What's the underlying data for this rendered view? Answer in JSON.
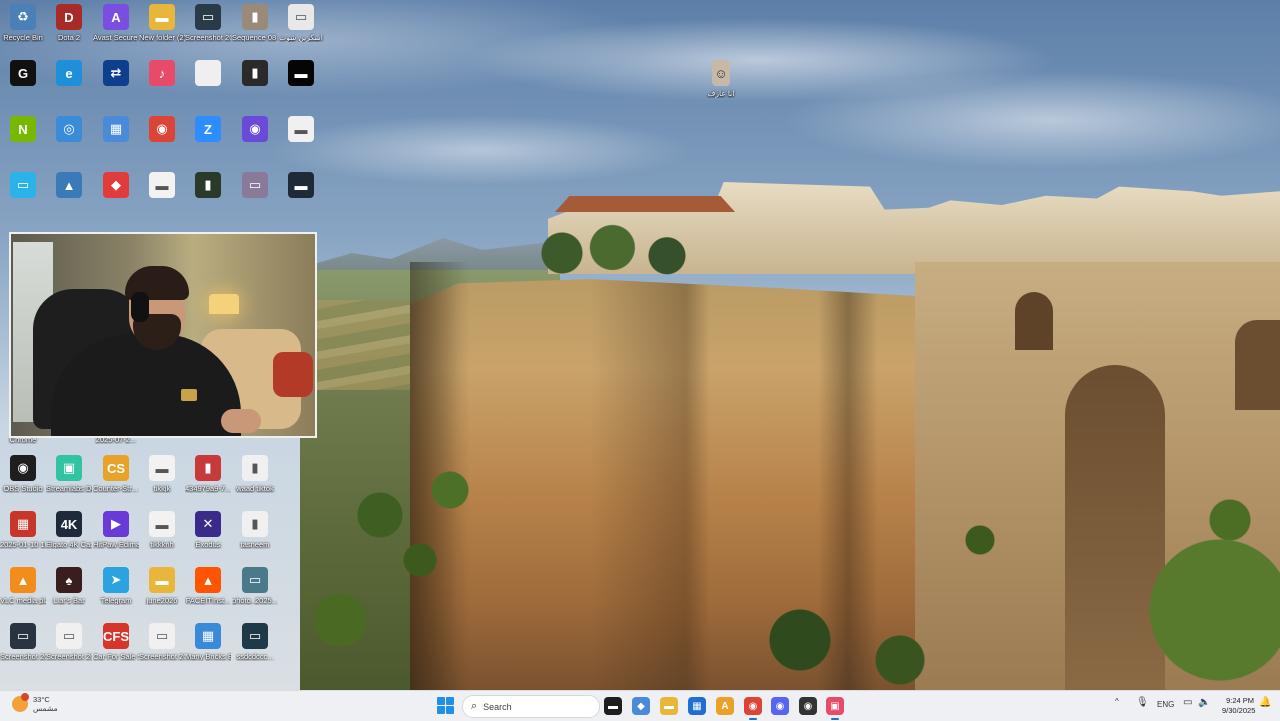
{
  "desktop": {
    "icons": [
      {
        "label": "Recycle Bin",
        "icon": "recycle-bin-icon",
        "color": "#4a7fb8",
        "glyph": "♻"
      },
      {
        "label": "Dota 2",
        "icon": "dota2-icon",
        "color": "#a82b28",
        "glyph": "D"
      },
      {
        "label": "Avast Secure Browser",
        "icon": "avast-browser-icon",
        "color": "#7a4ee0",
        "glyph": "A"
      },
      {
        "label": "New folder (2)",
        "icon": "folder-icon",
        "color": "#e8b63a",
        "glyph": "▬"
      },
      {
        "label": "Screenshot 2025-0...",
        "icon": "screenshot-file-icon",
        "color": "#2a3b48",
        "glyph": "▭"
      },
      {
        "label": "Sequence 08_1",
        "icon": "video-file-icon",
        "color": "#9a8a7a",
        "glyph": "▮"
      },
      {
        "label": "اسكرين شوت",
        "icon": "image-file-icon",
        "color": "#e8e8e8",
        "glyph": "▭"
      },
      {
        "label": "",
        "icon": "g-hub-icon",
        "color": "#111111",
        "glyph": "G"
      },
      {
        "label": "",
        "icon": "edge-icon",
        "color": "#1e8fd8",
        "glyph": "e"
      },
      {
        "label": "",
        "icon": "teamviewer-icon",
        "color": "#0e3f8c",
        "glyph": "⇄"
      },
      {
        "label": "",
        "icon": "tiktok-studio-icon",
        "color": "#e84a6a",
        "glyph": "♪"
      },
      {
        "label": "",
        "icon": "blank-file-icon",
        "color": "#efefef",
        "glyph": ""
      },
      {
        "label": "",
        "icon": "dark-image-icon",
        "color": "#2a2a2a",
        "glyph": "▮"
      },
      {
        "label": "",
        "icon": "black-file-icon",
        "color": "#050505",
        "glyph": "▬"
      },
      {
        "label": "",
        "icon": "nvidia-icon",
        "color": "#76b900",
        "glyph": "N"
      },
      {
        "label": "",
        "icon": "network-globe-icon",
        "color": "#3a8bd8",
        "glyph": "◎"
      },
      {
        "label": "",
        "icon": "windows-app-icon",
        "color": "#4a8ad8",
        "glyph": "▦"
      },
      {
        "label": "",
        "icon": "chrome-icon",
        "color": "#db4437",
        "glyph": "◉"
      },
      {
        "label": "",
        "icon": "zoom-icon",
        "color": "#2d8cff",
        "glyph": "Z"
      },
      {
        "label": "",
        "icon": "obs-like-icon",
        "color": "#6a4bd8",
        "glyph": "◉"
      },
      {
        "label": "",
        "icon": "white-file-icon",
        "color": "#f0f0f0",
        "glyph": "▬"
      },
      {
        "label": "",
        "icon": "monitor-icon",
        "color": "#2bb2e8",
        "glyph": "▭"
      },
      {
        "label": "",
        "icon": "game-icon",
        "color": "#3a7ab8",
        "glyph": "▲"
      },
      {
        "label": "",
        "icon": "anydesk-icon",
        "color": "#e23b3b",
        "glyph": "◆"
      },
      {
        "label": "",
        "icon": "document-icon",
        "color": "#f2f2f2",
        "glyph": "▬"
      },
      {
        "label": "",
        "icon": "phone-image-icon",
        "color": "#2a3a2a",
        "glyph": "▮"
      },
      {
        "label": "",
        "icon": "photo-icon",
        "color": "#8a7a9a",
        "glyph": "▭"
      },
      {
        "label": "",
        "icon": "dark-file-icon",
        "color": "#1e2a38",
        "glyph": "▬"
      },
      {
        "label": "Chrome",
        "icon": "chrome-shortcut-icon",
        "color": "#db4437",
        "glyph": "◉"
      },
      {
        "label": "2025-07-2...",
        "icon": "file-icon",
        "color": "#777777",
        "glyph": "▭"
      },
      {
        "label": "OBS Studio",
        "icon": "obs-studio-icon",
        "color": "#1e1e1e",
        "glyph": "◉"
      },
      {
        "label": "Streamlabs Desktop",
        "icon": "streamlabs-icon",
        "color": "#31c3a2",
        "glyph": "▣"
      },
      {
        "label": "Counter-Str... 2",
        "icon": "counter-strike-icon",
        "color": "#e8a22a",
        "glyph": "CS"
      },
      {
        "label": "tikkjk",
        "icon": "white-file-icon",
        "color": "#f2f2f2",
        "glyph": "▬"
      },
      {
        "label": "434979a9-7...",
        "icon": "image-file-icon",
        "color": "#c83a3a",
        "glyph": "▮"
      },
      {
        "label": "waad tiktok",
        "icon": "phone-file-icon",
        "color": "#f0f0f0",
        "glyph": "▮"
      },
      {
        "label": "2025-01-10 10-37-52",
        "icon": "archive-icon",
        "color": "#c8352a",
        "glyph": "▦"
      },
      {
        "label": "Elgato 4K Capture...",
        "icon": "elgato-4k-icon",
        "color": "#1e2a3a",
        "glyph": "4K"
      },
      {
        "label": "HitPaw Edimakor",
        "icon": "hitpaw-icon",
        "color": "#6a3ad8",
        "glyph": "▶"
      },
      {
        "label": "tikkknh",
        "icon": "white-file-icon",
        "color": "#f2f2f2",
        "glyph": "▬"
      },
      {
        "label": "Exodus",
        "icon": "exodus-icon",
        "color": "#3a2a8a",
        "glyph": "✕"
      },
      {
        "label": "tasneem",
        "icon": "phone-file-icon",
        "color": "#f0f0f0",
        "glyph": "▮"
      },
      {
        "label": "VLC media player",
        "icon": "vlc-icon",
        "color": "#f28c1a",
        "glyph": "▲"
      },
      {
        "label": "Liar's Bar",
        "icon": "liars-bar-icon",
        "color": "#3a1e1e",
        "glyph": "♠"
      },
      {
        "label": "Telegram",
        "icon": "telegram-icon",
        "color": "#2aa3e0",
        "glyph": "➤"
      },
      {
        "label": "june2026",
        "icon": "folder-icon",
        "color": "#e8b63a",
        "glyph": "▬"
      },
      {
        "label": "FACEITInst...",
        "icon": "faceit-icon",
        "color": "#ff5500",
        "glyph": "▲"
      },
      {
        "label": "photo_2025...",
        "icon": "photo-icon",
        "color": "#4a7a8a",
        "glyph": "▭"
      },
      {
        "label": "Screenshot 2025-09-08...",
        "icon": "screenshot-file-icon",
        "color": "#2a3440",
        "glyph": "▭"
      },
      {
        "label": "Screenshot 2025-09-...",
        "icon": "screenshot-file-icon",
        "color": "#f0f0f0",
        "glyph": "▭"
      },
      {
        "label": "Car For Sale Simulator ...",
        "icon": "car-for-sale-icon",
        "color": "#d8352a",
        "glyph": "CFS"
      },
      {
        "label": "Screenshot 2025-06-28...",
        "icon": "screenshot-file-icon",
        "color": "#f0f0f0",
        "glyph": "▭"
      },
      {
        "label": "Many Bricks Breaker",
        "icon": "bricks-game-icon",
        "color": "#3a8ad8",
        "glyph": "▦"
      },
      {
        "label": "ssdcdccc...",
        "icon": "screenshot-file-icon",
        "color": "#1e3a48",
        "glyph": "▭"
      }
    ],
    "wallpaper_icon": {
      "label": "انا عارف",
      "icon": "person-image-icon",
      "color": "#c8b8a8"
    }
  },
  "webcam": {
    "label": "webcam overlay"
  },
  "taskbar": {
    "weather": {
      "temp": "33°C",
      "condition": "مشمس"
    },
    "search": {
      "placeholder": "Search"
    },
    "apps": [
      {
        "name": "file-explorer-app",
        "glyph": "▬",
        "color": "#1e1e1e"
      },
      {
        "name": "copilot-app",
        "glyph": "◆",
        "color": "#4a8ad8"
      },
      {
        "name": "folder-app",
        "glyph": "▬",
        "color": "#e8b63a"
      },
      {
        "name": "store-app",
        "glyph": "▦",
        "color": "#1e6fd1"
      },
      {
        "name": "avast-app",
        "glyph": "A",
        "color": "#e8a22a"
      },
      {
        "name": "chrome-app",
        "glyph": "◉",
        "color": "#db4437"
      },
      {
        "name": "discord-app",
        "glyph": "◉",
        "color": "#5865f2"
      },
      {
        "name": "settings-app",
        "glyph": "◉",
        "color": "#333333"
      },
      {
        "name": "obs-app",
        "glyph": "▣",
        "color": "#e84a6a"
      }
    ],
    "tray": {
      "chevron": "^",
      "language": "ENG"
    },
    "clock": {
      "time": "9:24 PM",
      "date": "9/30/2025"
    }
  }
}
